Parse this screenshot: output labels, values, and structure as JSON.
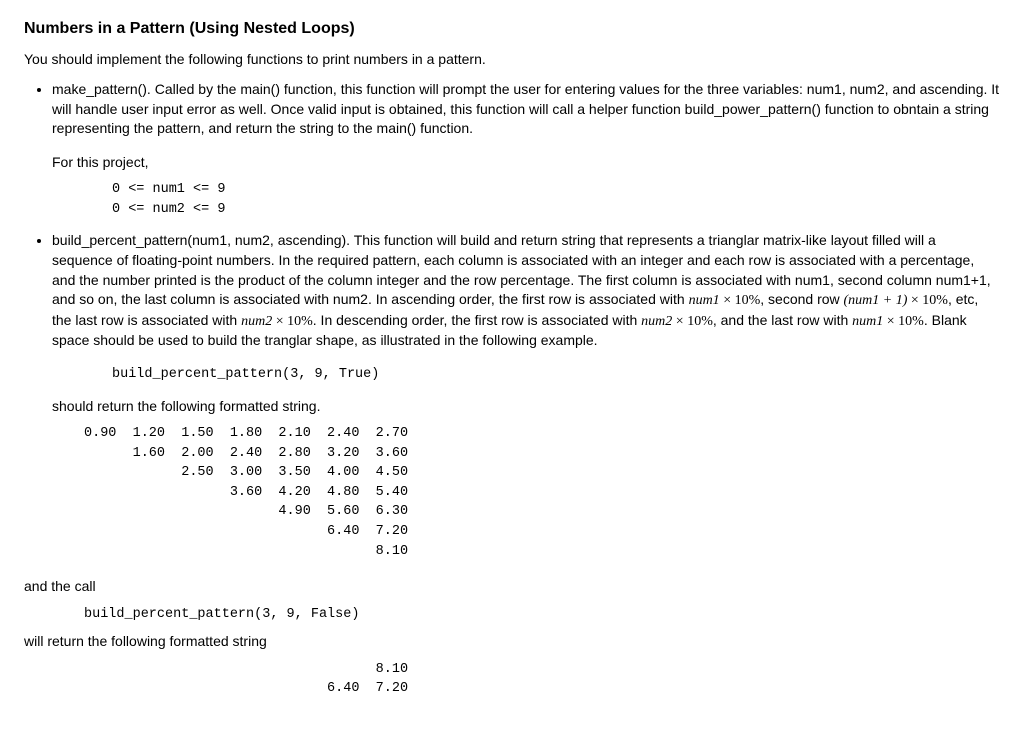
{
  "title": "Numbers in a Pattern (Using Nested Loops)",
  "intro": "You should implement the following functions to print numbers in a pattern.",
  "bullet1": {
    "p1": "make_pattern(). Called by the main() function, this function will prompt the user for entering values for the three variables: num1, num2, and ascending. It will handle user input error as well. Once valid input is obtained, this function will call a helper function build_power_pattern() function to obntain a string representing the pattern, and return the string to the main() function.",
    "p2": "For this project,",
    "code": "0 <= num1 <= 9\n0 <= num2 <= 9"
  },
  "bullet2": {
    "t1": "build_percent_pattern(num1, num2, ascending). This function will build and return string that represents a trianglar matrix-like layout filled will a sequence of floating-point numbers. In the required pattern, each column is associated with an integer and each row is associated with a percentage, and the number printed is the product of the column integer and the row percentage. The first column is associated with num1, second column num1+1, and so on, the last column is associated with num2. In ascending order, the first row is associated with ",
    "m1a": "num1",
    "m1b": " × 10%",
    "t2": ", second row ",
    "m2a": "(num1 + 1)",
    "m2b": " × 10%",
    "t3": ", etc, the last row is associated with ",
    "m3a": "num2",
    "m3b": " × 10%",
    "t4": ". In descending order, the first row is associated with ",
    "m4a": "num2",
    "m4b": " × 10%",
    "t5": ", and the last row with ",
    "m5a": "num1",
    "m5b": " × 10%",
    "t6": ". Blank space should be used to build the tranglar shape, as illustrated in the following example.",
    "call1": "build_percent_pattern(3, 9, True)",
    "should": "should return the following formatted string.",
    "out1": "0.90  1.20  1.50  1.80  2.10  2.40  2.70\n      1.60  2.00  2.40  2.80  3.20  3.60\n            2.50  3.00  3.50  4.00  4.50\n                  3.60  4.20  4.80  5.40\n                        4.90  5.60  6.30\n                              6.40  7.20\n                                    8.10",
    "andcall": "and the call",
    "call2": "build_percent_pattern(3, 9, False)",
    "will": "will return the following formatted string",
    "out2": "                                    8.10\n                              6.40  7.20"
  }
}
